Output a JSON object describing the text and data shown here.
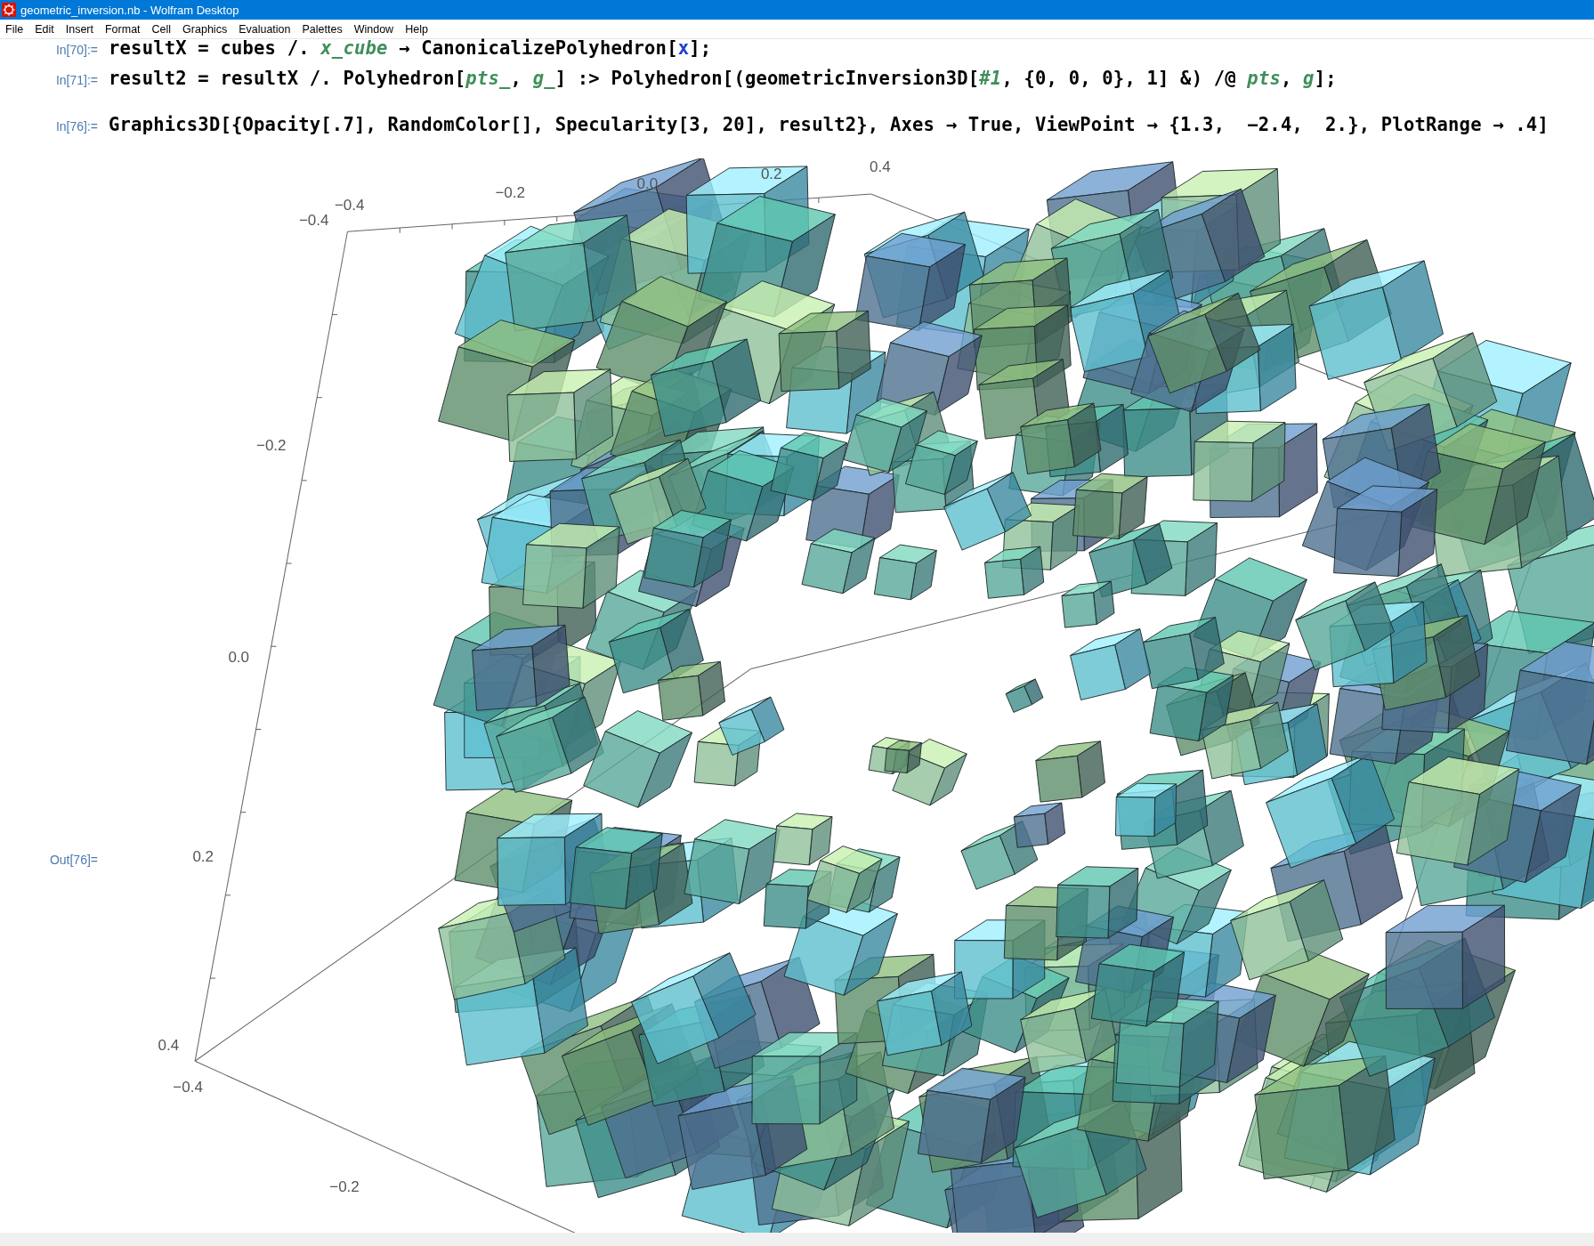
{
  "window": {
    "title": "geometric_inversion.nb - Wolfram Desktop"
  },
  "menu": [
    "File",
    "Edit",
    "Insert",
    "Format",
    "Cell",
    "Graphics",
    "Evaluation",
    "Palettes",
    "Window",
    "Help"
  ],
  "cells": [
    {
      "label": "In[70]:=",
      "tokens": [
        {
          "text": "resultX = cubes /. ",
          "kind": "plain"
        },
        {
          "text": "x_cube",
          "kind": "pattern"
        },
        {
          "text": " → CanonicalizePolyhedron[",
          "kind": "plain"
        },
        {
          "text": "x",
          "kind": "local"
        },
        {
          "text": "];",
          "kind": "plain"
        }
      ]
    },
    {
      "label": "In[71]:=",
      "tokens": [
        {
          "text": "result2 = resultX /. Polyhedron[",
          "kind": "plain"
        },
        {
          "text": "pts_",
          "kind": "pattern"
        },
        {
          "text": ", ",
          "kind": "plain"
        },
        {
          "text": "g_",
          "kind": "pattern"
        },
        {
          "text": "] :> Polyhedron[(geometricInversion3D[",
          "kind": "plain"
        },
        {
          "text": "#1",
          "kind": "pattern"
        },
        {
          "text": ", {0, 0, 0}, 1] &) /@ ",
          "kind": "plain"
        },
        {
          "text": "pts",
          "kind": "pattern"
        },
        {
          "text": ", ",
          "kind": "plain"
        },
        {
          "text": "g",
          "kind": "pattern"
        },
        {
          "text": "];",
          "kind": "plain"
        }
      ]
    },
    {
      "label": "In[76]:=",
      "tokens": [
        {
          "text": "Graphics3D[{Opacity[.7], RandomColor[], Specularity[3, 20], result2}, Axes → True, ViewPoint → {1.3,  −2.4,  2.}, PlotRange → .4]",
          "kind": "plain"
        }
      ]
    }
  ],
  "output": {
    "label": "Out[76]=",
    "tick_labels": [
      "−0.4",
      "−0.2",
      "0.0",
      "0.2",
      "0.4",
      "−0.4",
      "−0.2",
      "0.0",
      "0.2",
      "0.4",
      "−0.4",
      "−0.2"
    ]
  }
}
